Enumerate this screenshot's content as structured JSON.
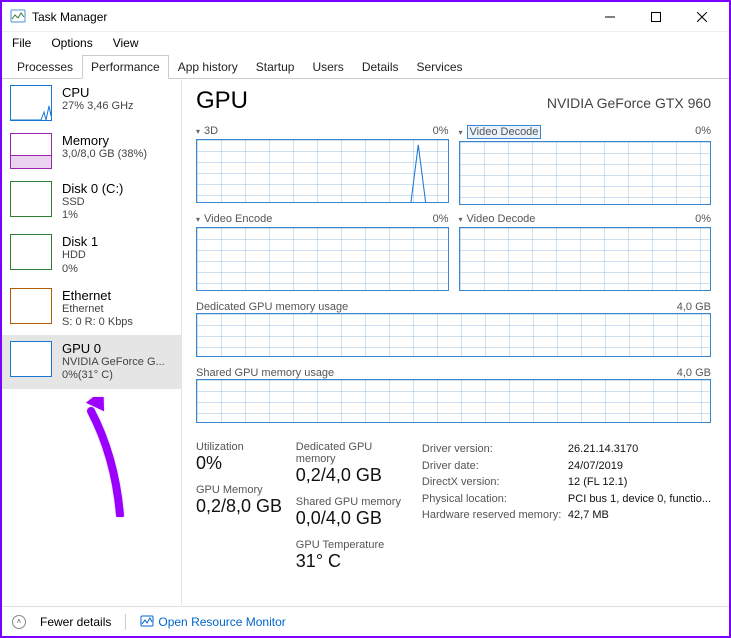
{
  "window": {
    "title": "Task Manager"
  },
  "menu": {
    "file": "File",
    "options": "Options",
    "view": "View"
  },
  "tabs": {
    "processes": "Processes",
    "performance": "Performance",
    "app_history": "App history",
    "startup": "Startup",
    "users": "Users",
    "details": "Details",
    "services": "Services"
  },
  "sidebar": {
    "cpu": {
      "title": "CPU",
      "sub": "27% 3,46 GHz"
    },
    "mem": {
      "title": "Memory",
      "sub": "3,0/8,0 GB (38%)"
    },
    "disk0": {
      "title": "Disk 0 (C:)",
      "sub1": "SSD",
      "sub2": "1%"
    },
    "disk1": {
      "title": "Disk 1",
      "sub1": "HDD",
      "sub2": "0%"
    },
    "eth": {
      "title": "Ethernet",
      "sub1": "Ethernet",
      "sub2": "S: 0 R: 0 Kbps"
    },
    "gpu": {
      "title": "GPU 0",
      "sub1": "NVIDIA GeForce G...",
      "sub2": "0%(31° C)"
    }
  },
  "main": {
    "heading": "GPU",
    "device": "NVIDIA GeForce GTX 960",
    "g0": {
      "label": "3D",
      "pct": "0%"
    },
    "g1": {
      "label": "Video Decode",
      "pct": "0%"
    },
    "g2": {
      "label": "Video Encode",
      "pct": "0%"
    },
    "g3": {
      "label": "Video Decode",
      "pct": "0%"
    },
    "dedicated": {
      "label": "Dedicated GPU memory usage",
      "max": "4,0 GB"
    },
    "shared": {
      "label": "Shared GPU memory usage",
      "max": "4,0 GB"
    }
  },
  "stats": {
    "util_label": "Utilization",
    "util_val": "0%",
    "gpumem_label": "GPU Memory",
    "gpumem_val": "0,2/8,0 GB",
    "ded_label": "Dedicated GPU memory",
    "ded_val": "0,2/4,0 GB",
    "sh_label": "Shared GPU memory",
    "sh_val": "0,0/4,0 GB",
    "temp_label": "GPU Temperature",
    "temp_val": "31° C",
    "drv_ver_k": "Driver version:",
    "drv_ver_v": "26.21.14.3170",
    "drv_date_k": "Driver date:",
    "drv_date_v": "24/07/2019",
    "dx_k": "DirectX version:",
    "dx_v": "12 (FL 12.1)",
    "loc_k": "Physical location:",
    "loc_v": "PCI bus 1, device 0, functio...",
    "hw_k": "Hardware reserved memory:",
    "hw_v": "42,7 MB"
  },
  "footer": {
    "fewer": "Fewer details",
    "monitor": "Open Resource Monitor"
  }
}
